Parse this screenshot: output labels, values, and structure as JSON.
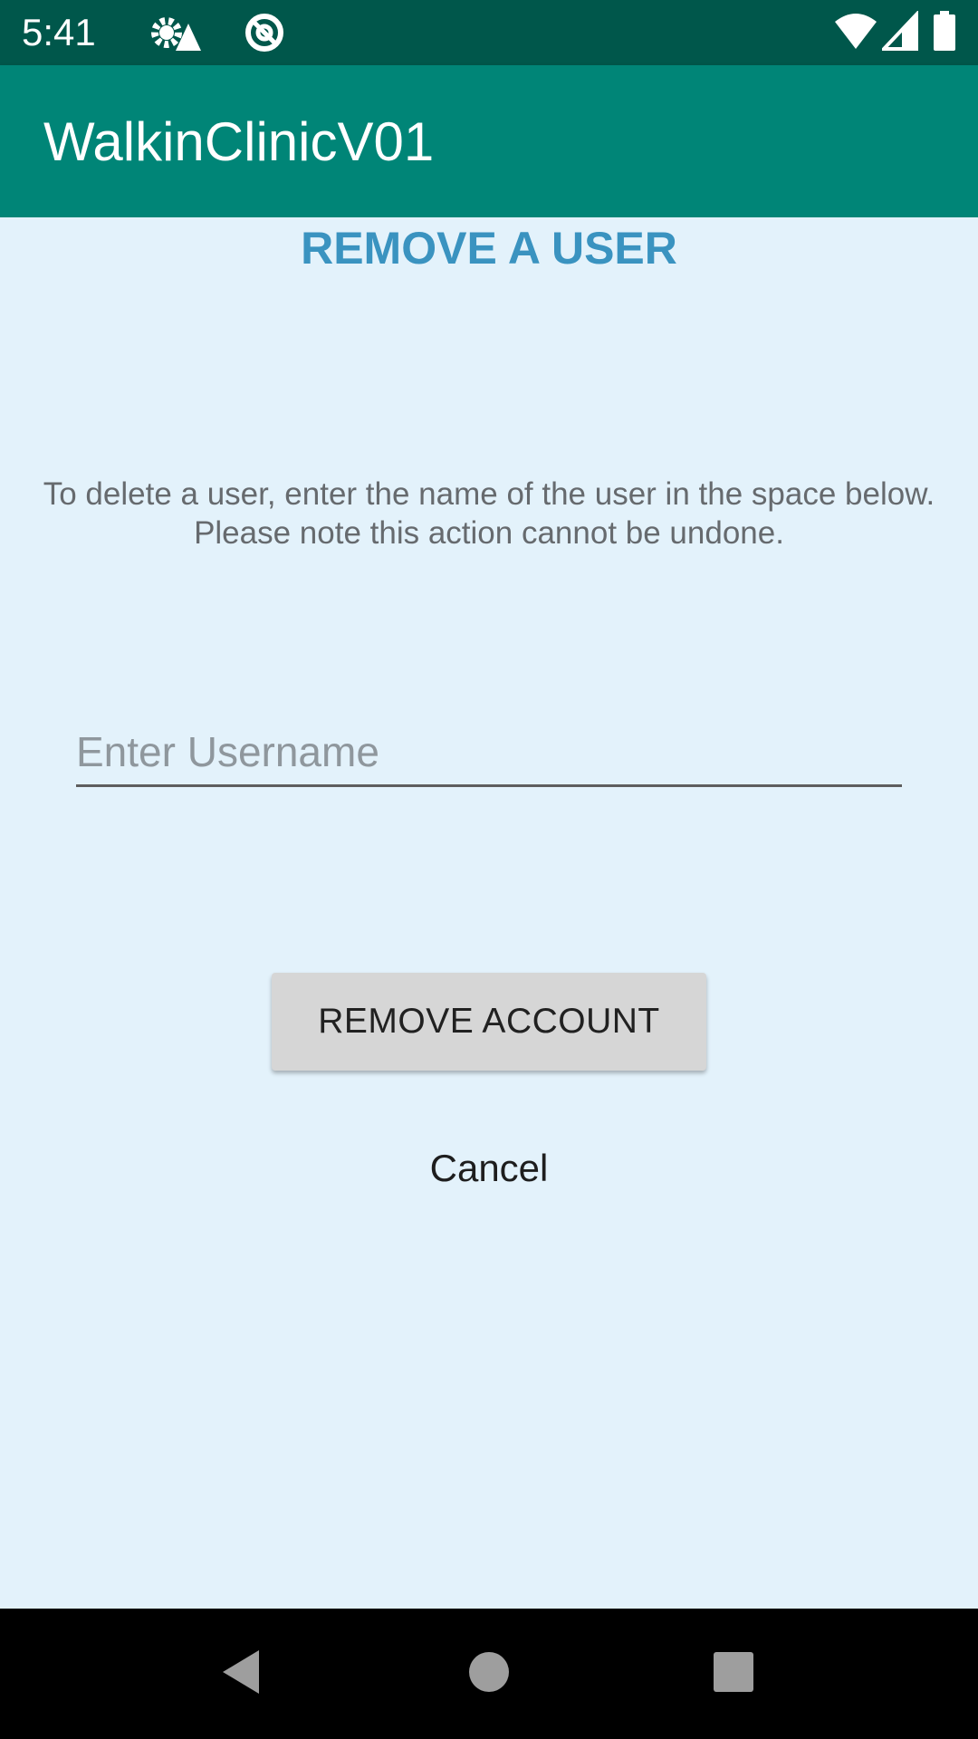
{
  "status_bar": {
    "time": "5:41",
    "icons": [
      "settings-alert-icon",
      "do-not-disturb-icon",
      "wifi-icon",
      "signal-icon",
      "battery-icon"
    ]
  },
  "app_bar": {
    "title": "WalkinClinicV01",
    "color": "#008577"
  },
  "main": {
    "heading": "REMOVE A USER",
    "instructions": [
      "To delete a user, enter the name of the user in the space below.",
      "Please note this action cannot be undone."
    ],
    "username_input": {
      "placeholder": "Enter Username",
      "value": ""
    },
    "remove_button_label": "REMOVE ACCOUNT",
    "cancel_label": "Cancel"
  },
  "nav_bar": {
    "icons": [
      "back-icon",
      "home-icon",
      "recents-icon"
    ]
  },
  "colors": {
    "background": "#E3F2FB",
    "heading": "#3A93C0",
    "status_bar": "#00574B"
  }
}
